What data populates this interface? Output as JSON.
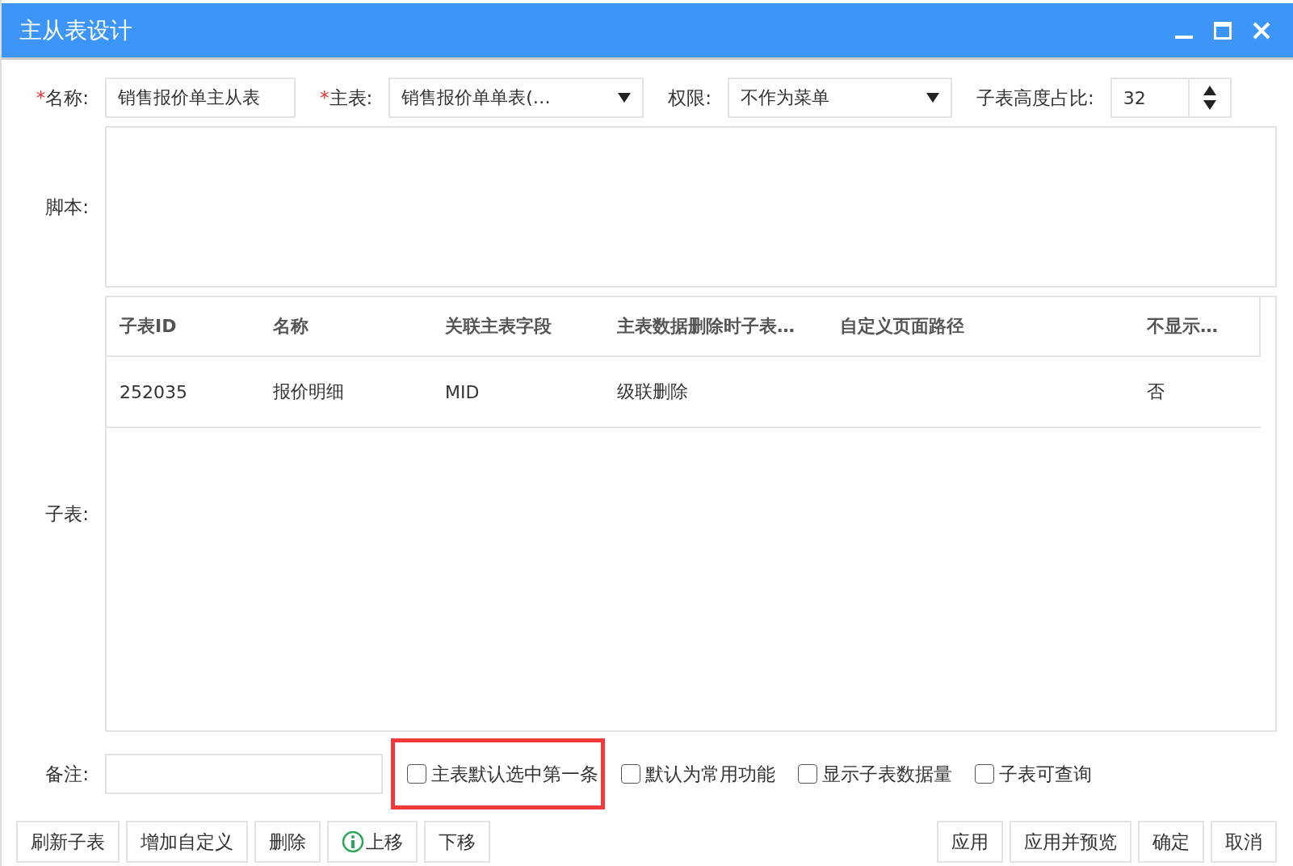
{
  "window": {
    "title": "主从表设计"
  },
  "form": {
    "name": {
      "mark": "*",
      "label": "名称:",
      "value": "销售报价单主从表"
    },
    "master": {
      "mark": "*",
      "label": "主表:",
      "value": "销售报价单单表(…"
    },
    "permission": {
      "label": "权限:",
      "value": "不作为菜单"
    },
    "ratio": {
      "label": "子表高度占比:",
      "value": "32"
    },
    "script": {
      "label": "脚本:"
    },
    "subtable": {
      "label": "子表:"
    },
    "note": {
      "label": "备注:"
    }
  },
  "table": {
    "columns": [
      "子表ID",
      "名称",
      "关联主表字段",
      "主表数据删除时子表…",
      "自定义页面路径",
      "不显示…"
    ],
    "rows": [
      [
        "252035",
        "报价明细",
        "MID",
        "级联删除",
        "",
        "否"
      ]
    ]
  },
  "options": [
    {
      "label": "主表默认选中第一条",
      "checked": false,
      "highlighted": true
    },
    {
      "label": "默认为常用功能",
      "checked": false,
      "highlighted": false
    },
    {
      "label": "显示子表数据量",
      "checked": false,
      "highlighted": false
    },
    {
      "label": "子表可查询",
      "checked": false,
      "highlighted": false
    }
  ],
  "left_buttons": [
    {
      "label": "刷新子表",
      "icon": false
    },
    {
      "label": "增加自定义",
      "icon": false
    },
    {
      "label": "删除",
      "icon": false
    },
    {
      "label": "上移",
      "icon": true
    },
    {
      "label": "下移",
      "icon": false
    }
  ],
  "right_buttons": [
    "应用",
    "应用并预览",
    "确定",
    "取消"
  ]
}
